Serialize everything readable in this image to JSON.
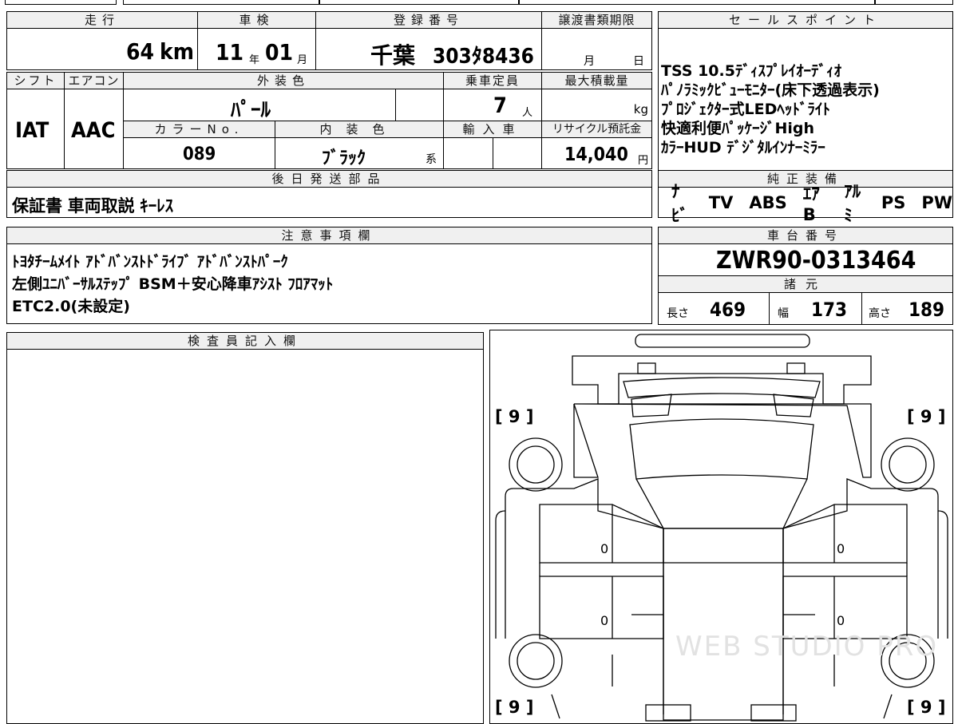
{
  "headers": {
    "mileage": "走行",
    "inspection": "車検",
    "registration": "登録番号",
    "transfer_deadline": "譲渡書類期限",
    "sales_point": "セールスポイント",
    "shift": "シフト",
    "aircon": "エアコン",
    "exterior_color": "外装色",
    "capacity": "乗車定員",
    "max_load": "最大積載量",
    "color_no": "カラーNo.",
    "interior_color": "内装色",
    "import": "輸入車",
    "recycle": "リサイクル預託金",
    "later_parts": "後日発送部品",
    "genuine_equipment": "純正装備",
    "notes": "注意事項欄",
    "chassis_no": "車台番号",
    "specs": "諸元",
    "inspector": "検査員記入欄"
  },
  "vehicle": {
    "mileage_value": "64",
    "mileage_unit": "km",
    "inspection_year": "11",
    "year_unit": "年",
    "inspection_month": "01",
    "month_unit": "月",
    "plate_area": "千葉",
    "plate_number": "303ﾀ8436",
    "deadline_month_label": "月",
    "deadline_day_label": "日",
    "shift": "IAT",
    "aircon": "AAC",
    "exterior_color": "ﾊﾟｰﾙ",
    "capacity_value": "7",
    "capacity_unit": "人",
    "max_load_unit": "kg",
    "color_no": "089",
    "interior_color": "ﾌﾞﾗｯｸ",
    "interior_suffix": "系",
    "recycle_value": "14,040",
    "recycle_unit": "円",
    "later_parts": "保証書 車両取説 ｷｰﾚｽ",
    "chassis_no": "ZWR90-0313464"
  },
  "sales_points": [
    "TSS 10.5ﾃﾞｨｽﾌﾟﾚｲｵｰﾃﾞｨｵ",
    "ﾊﾟﾉﾗﾐｯｸﾋﾞｭｰﾓﾆﾀｰ(床下透過表示)",
    "ﾌﾟﾛｼﾞｪｸﾀｰ式LEDﾍｯﾄﾞﾗｲﾄ",
    "快適利便ﾊﾟｯｹｰｼﾞHigh",
    "ｶﾗｰHUD ﾃﾞｼﾞﾀﾙｲﾝﾅｰﾐﾗｰ"
  ],
  "equipment": [
    "ﾅﾋﾞ",
    "TV",
    "ABS",
    "ｴｱB",
    "ｱﾙﾐ",
    "PS",
    "PW"
  ],
  "notes": [
    "ﾄﾖﾀﾁｰﾑﾒｲﾄ ｱﾄﾞﾊﾞﾝｽﾄﾄﾞﾗｲﾌﾞ ｱﾄﾞﾊﾞﾝｽﾄﾊﾟｰｸ",
    "左側ﾕﾆﾊﾞｰｻﾙｽﾃｯﾌﾟ BSM＋安心降車ｱｼｽﾄ ﾌﾛｱﾏｯﾄ",
    "ETC2.0(未設定)"
  ],
  "specs": {
    "length_label": "長さ",
    "length_value": "469",
    "width_label": "幅",
    "width_value": "173",
    "height_label": "高さ",
    "height_value": "189"
  },
  "diagram": {
    "tire_labels": [
      "[ 9 ]",
      "[ 9 ]",
      "[ 9 ]",
      "[ 9 ]"
    ],
    "door_marks": [
      "0",
      "0",
      "0",
      "0"
    ],
    "watermark": "WEB STUDIO PRO"
  }
}
